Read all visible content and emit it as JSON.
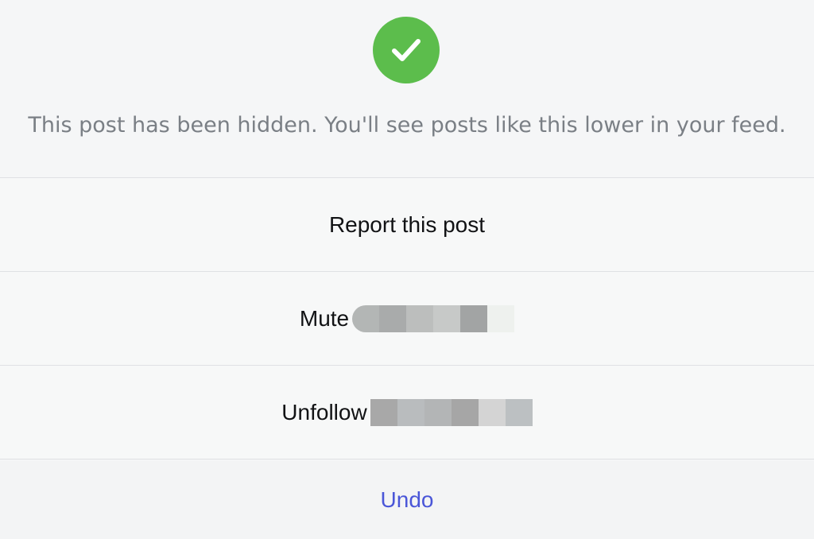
{
  "status": {
    "icon": "checkmark-circle-icon",
    "color": "#5cbd4c",
    "message": "This post has been hidden. You'll see posts like this lower in your feed."
  },
  "options": {
    "report_label": "Report this post",
    "mute_label": "Mute",
    "unfollow_label": "Unfollow"
  },
  "undo": {
    "label": "Undo",
    "color": "#4a56d8"
  }
}
